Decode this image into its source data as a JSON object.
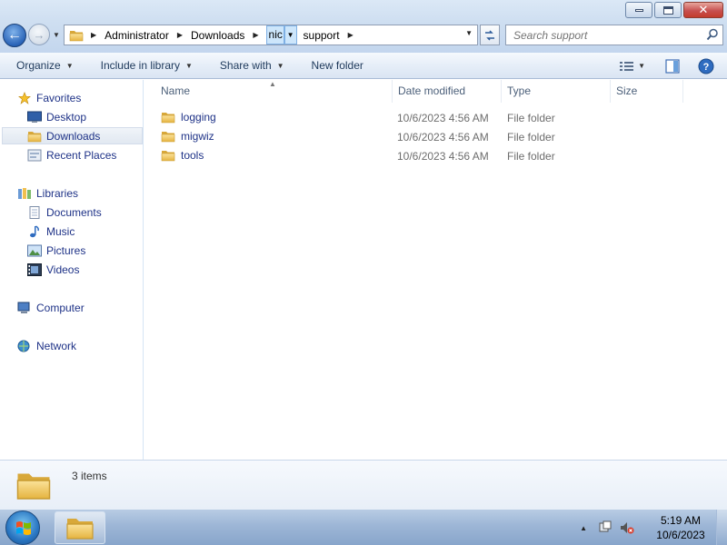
{
  "window": {
    "controls": {
      "minimize": "minimize-icon",
      "maximize": "restore-icon",
      "close": "close-icon"
    }
  },
  "address_bar": {
    "breadcrumbs": [
      "Administrator",
      "Downloads",
      "nic",
      "support"
    ],
    "refresh_icon": "refresh-icon"
  },
  "search": {
    "placeholder": "Search support",
    "value": ""
  },
  "toolbar": {
    "organize": "Organize",
    "include_in_library": "Include in library",
    "share_with": "Share with",
    "new_folder": "New folder"
  },
  "nav": {
    "favorites": {
      "label": "Favorites",
      "items": [
        {
          "label": "Desktop",
          "icon": "desktop-icon"
        },
        {
          "label": "Downloads",
          "icon": "downloads-folder-icon",
          "selected": true
        },
        {
          "label": "Recent Places",
          "icon": "recent-places-icon"
        }
      ]
    },
    "libraries": {
      "label": "Libraries",
      "items": [
        {
          "label": "Documents",
          "icon": "documents-icon"
        },
        {
          "label": "Music",
          "icon": "music-icon"
        },
        {
          "label": "Pictures",
          "icon": "pictures-icon"
        },
        {
          "label": "Videos",
          "icon": "videos-icon"
        }
      ]
    },
    "computer": {
      "label": "Computer"
    },
    "network": {
      "label": "Network"
    }
  },
  "columns": {
    "name": "Name",
    "date": "Date modified",
    "type": "Type",
    "size": "Size"
  },
  "files": [
    {
      "name": "logging",
      "date": "10/6/2023 4:56 AM",
      "type": "File folder"
    },
    {
      "name": "migwiz",
      "date": "10/6/2023 4:56 AM",
      "type": "File folder"
    },
    {
      "name": "tools",
      "date": "10/6/2023 4:56 AM",
      "type": "File folder"
    }
  ],
  "details": {
    "count": "3 items"
  },
  "taskbar": {
    "time": "5:19 AM",
    "date": "10/6/2023"
  },
  "colors": {
    "link_text": "#1e3287",
    "toolbar_bg": "#e6eef8",
    "taskbar_bg": "#9db6d6",
    "folder_yellow": "#f1c75a"
  }
}
